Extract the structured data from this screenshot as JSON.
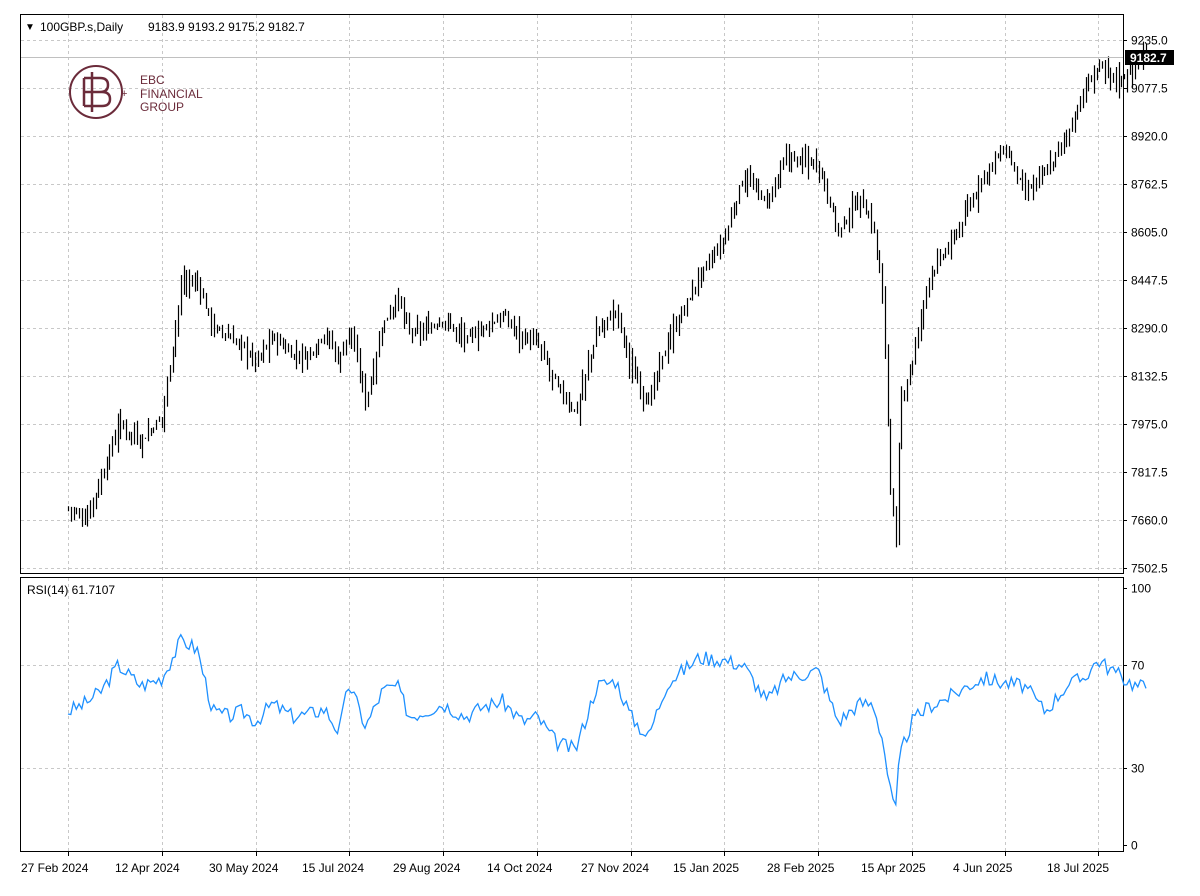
{
  "header": {
    "symbol_text": "100GBP.s,Daily",
    "ohlc_text": "9183.9 9193.2 9175.2 9182.7",
    "dropdown_glyph": "▼"
  },
  "logo": {
    "line1": "EBC",
    "line2": "FINANCIAL",
    "line3": "GROUP"
  },
  "price_panel": {
    "current_price_label": "9182.7",
    "y_ticks": [
      "9235.0",
      "9077.5",
      "8920.0",
      "8762.5",
      "8605.0",
      "8447.5",
      "8290.0",
      "8132.5",
      "7975.0",
      "7817.5",
      "7660.0",
      "7502.5"
    ]
  },
  "rsi_panel": {
    "title": "RSI(14) 61.7107",
    "y_ticks": [
      "100",
      "70",
      "30",
      "0"
    ],
    "line_color": "#1e90ff"
  },
  "x_axis": {
    "labels": [
      "27 Feb 2024",
      "12 Apr 2024",
      "30 May 2024",
      "15 Jul 2024",
      "29 Aug 2024",
      "14 Oct 2024",
      "27 Nov 2024",
      "15 Jan 2025",
      "28 Feb 2025",
      "15 Apr 2025",
      "4 Jun 2025",
      "18 Jul 2025"
    ]
  },
  "chart_data": [
    {
      "type": "ohlc",
      "symbol": "100GBP.s",
      "timeframe": "Daily",
      "last": {
        "open": 9183.9,
        "high": 9193.2,
        "low": 9175.2,
        "close": 9182.7
      },
      "ylim": [
        7502.5,
        9235.0
      ],
      "grid": true,
      "bar_color": "#000000",
      "x": [
        "2024-02-27",
        "2024-03-06",
        "2024-03-14",
        "2024-03-22",
        "2024-04-02",
        "2024-04-12",
        "2024-04-22",
        "2024-04-30",
        "2024-05-08",
        "2024-05-16",
        "2024-05-23",
        "2024-05-30",
        "2024-06-07",
        "2024-06-17",
        "2024-06-25",
        "2024-07-03",
        "2024-07-10",
        "2024-07-15",
        "2024-07-23",
        "2024-07-31",
        "2024-08-07",
        "2024-08-13",
        "2024-08-20",
        "2024-08-29",
        "2024-09-09",
        "2024-09-18",
        "2024-09-27",
        "2024-10-07",
        "2024-10-14",
        "2024-10-23",
        "2024-11-01",
        "2024-11-11",
        "2024-11-20",
        "2024-11-27",
        "2024-12-06",
        "2024-12-16",
        "2025-01-02",
        "2025-01-15",
        "2025-01-24",
        "2025-02-04",
        "2025-02-13",
        "2025-02-28",
        "2025-03-10",
        "2025-03-20",
        "2025-03-27",
        "2025-04-01",
        "2025-04-04",
        "2025-04-07",
        "2025-04-09",
        "2025-04-15",
        "2025-04-24",
        "2025-05-06",
        "2025-05-15",
        "2025-05-23",
        "2025-06-04",
        "2025-06-13",
        "2025-06-23",
        "2025-07-03",
        "2025-07-11",
        "2025-07-18",
        "2025-07-28",
        "2025-08-05",
        "2025-08-11"
      ],
      "close": [
        7700,
        7660,
        7800,
        7975,
        7920,
        8000,
        8440,
        8440,
        8290,
        8260,
        8230,
        8180,
        8260,
        8200,
        8200,
        8280,
        8180,
        8290,
        8050,
        8300,
        8390,
        8270,
        8280,
        8320,
        8250,
        8290,
        8330,
        8260,
        8240,
        8100,
        8010,
        8280,
        8350,
        8150,
        8050,
        8240,
        8460,
        8580,
        8790,
        8700,
        8850,
        8830,
        8600,
        8720,
        8620,
        8360,
        7800,
        7560,
        8040,
        8180,
        8460,
        8570,
        8680,
        8790,
        8880,
        8730,
        8800,
        8920,
        9060,
        9150,
        9100,
        9160,
        9183
      ]
    },
    {
      "type": "line",
      "title": "RSI(14) 61.7107",
      "ylim": [
        0,
        100
      ],
      "x": [
        "2024-02-27",
        "2024-03-06",
        "2024-03-14",
        "2024-03-22",
        "2024-04-02",
        "2024-04-12",
        "2024-04-22",
        "2024-04-30",
        "2024-05-08",
        "2024-05-16",
        "2024-05-23",
        "2024-05-30",
        "2024-06-07",
        "2024-06-17",
        "2024-06-25",
        "2024-07-03",
        "2024-07-10",
        "2024-07-15",
        "2024-07-23",
        "2024-07-31",
        "2024-08-07",
        "2024-08-13",
        "2024-08-20",
        "2024-08-29",
        "2024-09-09",
        "2024-09-18",
        "2024-09-27",
        "2024-10-07",
        "2024-10-14",
        "2024-10-23",
        "2024-11-01",
        "2024-11-11",
        "2024-11-20",
        "2024-11-27",
        "2024-12-06",
        "2024-12-16",
        "2025-01-02",
        "2025-01-15",
        "2025-01-24",
        "2025-02-04",
        "2025-02-13",
        "2025-02-28",
        "2025-03-10",
        "2025-03-20",
        "2025-03-27",
        "2025-04-01",
        "2025-04-04",
        "2025-04-07",
        "2025-04-09",
        "2025-04-15",
        "2025-04-24",
        "2025-05-06",
        "2025-05-15",
        "2025-05-23",
        "2025-06-04",
        "2025-06-13",
        "2025-06-23",
        "2025-07-03",
        "2025-07-11",
        "2025-07-18",
        "2025-07-28",
        "2025-08-05",
        "2025-08-11"
      ],
      "values": [
        52,
        55,
        60,
        70,
        62,
        65,
        80,
        76,
        52,
        50,
        52,
        48,
        55,
        50,
        51,
        53,
        44,
        63,
        46,
        60,
        62,
        50,
        52,
        55,
        50,
        54,
        56,
        48,
        50,
        40,
        37,
        62,
        64,
        50,
        42,
        63,
        73,
        72,
        70,
        56,
        65,
        68,
        48,
        55,
        55,
        40,
        22,
        13,
        35,
        48,
        54,
        58,
        62,
        65,
        63,
        62,
        52,
        62,
        65,
        72,
        66,
        62,
        61.7
      ]
    }
  ]
}
